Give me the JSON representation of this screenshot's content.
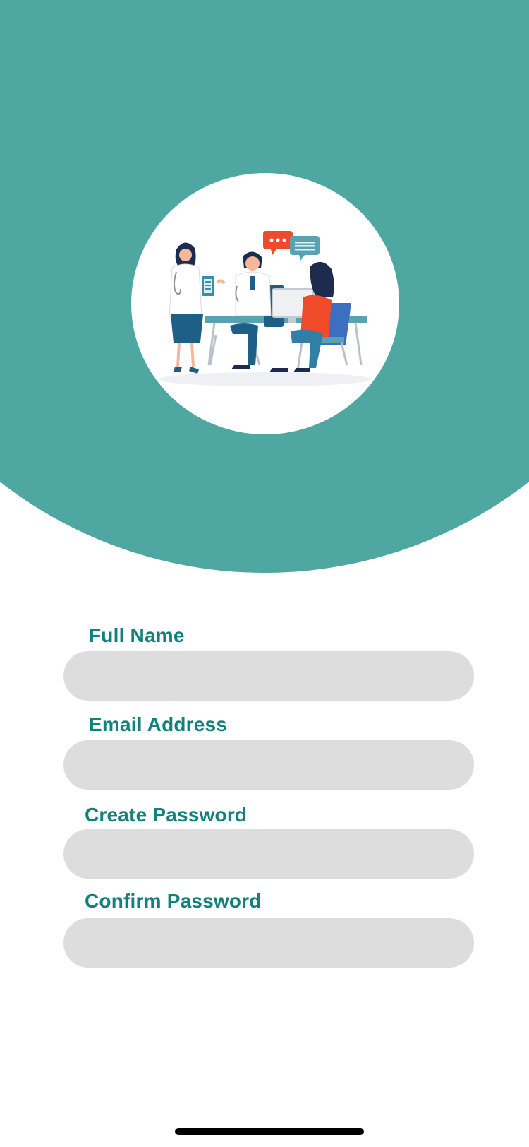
{
  "colors": {
    "brand_teal": "#4ea7a1",
    "label_teal": "#12807b",
    "input_bg": "#dddddd"
  },
  "hero": {
    "illustration_icon": "doctor-consultation-illustration"
  },
  "form": {
    "fields": [
      {
        "label": "Full Name",
        "value": "",
        "placeholder": ""
      },
      {
        "label": "Email Address",
        "value": "",
        "placeholder": ""
      },
      {
        "label": "Create Password",
        "value": "",
        "placeholder": ""
      },
      {
        "label": "Confirm Password",
        "value": "",
        "placeholder": ""
      }
    ]
  }
}
